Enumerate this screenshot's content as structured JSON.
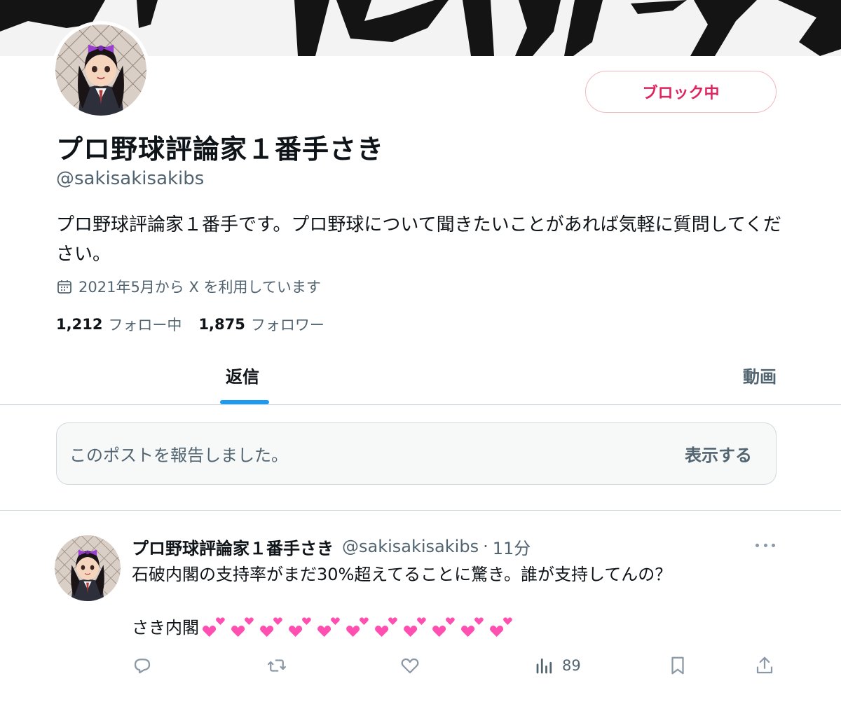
{
  "profile": {
    "display_name": "プロ野球評論家１番手さき",
    "handle": "@sakisakisakibs",
    "block_button": "ブロック中",
    "bio": "プロ野球評論家１番手です。プロ野球について聞きたいことがあれば気軽に質問してください。",
    "joined": "2021年5月から X を利用しています",
    "following_count": "1,212",
    "following_label": "フォロー中",
    "followers_count": "1,875",
    "followers_label": "フォロワー"
  },
  "tabs": [
    {
      "label": "返信",
      "active": true
    },
    {
      "label": "動画",
      "active": false
    }
  ],
  "reported_notice": {
    "text": "このポストを報告しました。",
    "button": "表示する"
  },
  "tweet": {
    "name": "プロ野球評論家１番手さき",
    "handle": "@sakisakisakibs",
    "separator": "·",
    "time": "11分",
    "line1": "石破内閣の支持率がまだ30%超えてることに驚き。誰が支持してんの？",
    "line2": "さき内閣",
    "emoji_name": "two-hearts",
    "emoji_count": 11,
    "views": "89",
    "actions": [
      "reply-icon",
      "retweet-icon",
      "like-icon",
      "views-icon",
      "bookmark-icon",
      "share-icon"
    ]
  },
  "colors": {
    "block_red": "#e0245e",
    "accent_blue": "#1d9bf0",
    "secondary_text": "#536471",
    "heart_pink": "#ff4fb0"
  }
}
